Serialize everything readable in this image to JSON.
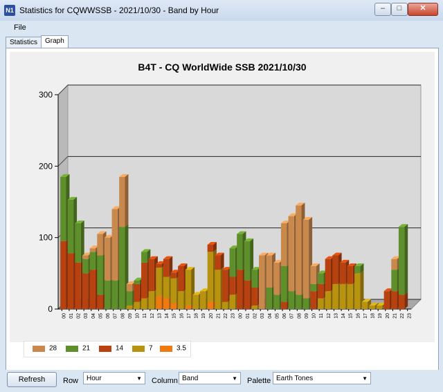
{
  "window": {
    "title": "Statistics for CQWWSSB - 2021/10/30 - Band by Hour",
    "icon_text": "N1"
  },
  "menu": {
    "file": "File"
  },
  "tabs": [
    {
      "label": "Statistics",
      "active": false
    },
    {
      "label": "Graph",
      "active": true
    }
  ],
  "controls": {
    "refresh_label": "Refresh",
    "row_label": "Row",
    "row_value": "Hour",
    "column_label": "Column",
    "column_value": "Band",
    "palette_label": "Palette",
    "palette_value": "Earth Tones"
  },
  "colors": {
    "b28": "#c9894d",
    "b21": "#5f8f2a",
    "b14": "#b8420f",
    "b7": "#b8930f",
    "b35": "#f07a12"
  },
  "chart_data": {
    "type": "bar",
    "stacked": true,
    "title": "B4T - CQ WorldWide SSB 2021/10/30",
    "ylim": [
      0,
      300
    ],
    "yticks": [
      0,
      100,
      200,
      300
    ],
    "grid": true,
    "legend_position": "bottom-left",
    "categories": [
      "00",
      "01",
      "02",
      "03",
      "04",
      "05",
      "06",
      "07",
      "08",
      "09",
      "10",
      "11",
      "12",
      "13",
      "14",
      "15",
      "16",
      "17",
      "18",
      "19",
      "20",
      "21",
      "22",
      "23",
      "00",
      "01",
      "02",
      "03",
      "04",
      "05",
      "06",
      "07",
      "08",
      "09",
      "10",
      "11",
      "12",
      "13",
      "14",
      "15",
      "16",
      "17",
      "18",
      "19",
      "20",
      "21",
      "22",
      "23"
    ],
    "series": [
      {
        "name": "28",
        "color_key": "b28",
        "values": [
          0,
          0,
          0,
          5,
          5,
          30,
          60,
          100,
          70,
          10,
          0,
          0,
          0,
          0,
          0,
          0,
          0,
          0,
          0,
          0,
          0,
          0,
          0,
          0,
          0,
          0,
          0,
          75,
          45,
          45,
          60,
          105,
          125,
          110,
          25,
          0,
          0,
          0,
          0,
          0,
          0,
          0,
          0,
          0,
          0,
          15,
          0,
          0
        ]
      },
      {
        "name": "21",
        "color_key": "b21",
        "values": [
          90,
          75,
          55,
          20,
          25,
          55,
          40,
          40,
          115,
          20,
          5,
          15,
          0,
          0,
          0,
          0,
          0,
          0,
          0,
          0,
          0,
          0,
          0,
          40,
          50,
          55,
          25,
          0,
          30,
          20,
          50,
          25,
          20,
          15,
          10,
          15,
          0,
          0,
          0,
          0,
          10,
          0,
          0,
          0,
          0,
          30,
          95,
          0
        ]
      },
      {
        "name": "14",
        "color_key": "b14",
        "values": [
          95,
          78,
          65,
          50,
          55,
          20,
          0,
          0,
          0,
          0,
          25,
          50,
          45,
          5,
          25,
          8,
          35,
          0,
          0,
          0,
          10,
          20,
          45,
          25,
          55,
          40,
          25,
          0,
          0,
          0,
          10,
          0,
          0,
          0,
          25,
          20,
          45,
          40,
          30,
          25,
          0,
          0,
          0,
          0,
          25,
          25,
          20,
          0
        ]
      },
      {
        "name": "7",
        "color_key": "b7",
        "values": [
          0,
          0,
          0,
          0,
          0,
          0,
          0,
          0,
          0,
          5,
          10,
          15,
          25,
          40,
          30,
          35,
          25,
          50,
          20,
          25,
          70,
          55,
          10,
          20,
          0,
          0,
          5,
          0,
          0,
          0,
          0,
          0,
          0,
          0,
          0,
          15,
          25,
          35,
          35,
          35,
          50,
          10,
          5,
          5,
          0,
          0,
          0,
          0
        ]
      },
      {
        "name": "3.5",
        "color_key": "b35",
        "values": [
          0,
          0,
          0,
          0,
          0,
          0,
          0,
          0,
          0,
          0,
          0,
          0,
          0,
          18,
          15,
          8,
          0,
          5,
          0,
          0,
          10,
          0,
          0,
          0,
          0,
          0,
          0,
          0,
          0,
          0,
          0,
          0,
          0,
          0,
          0,
          0,
          0,
          0,
          0,
          0,
          0,
          0,
          0,
          0,
          0,
          0,
          0,
          0
        ]
      }
    ]
  }
}
